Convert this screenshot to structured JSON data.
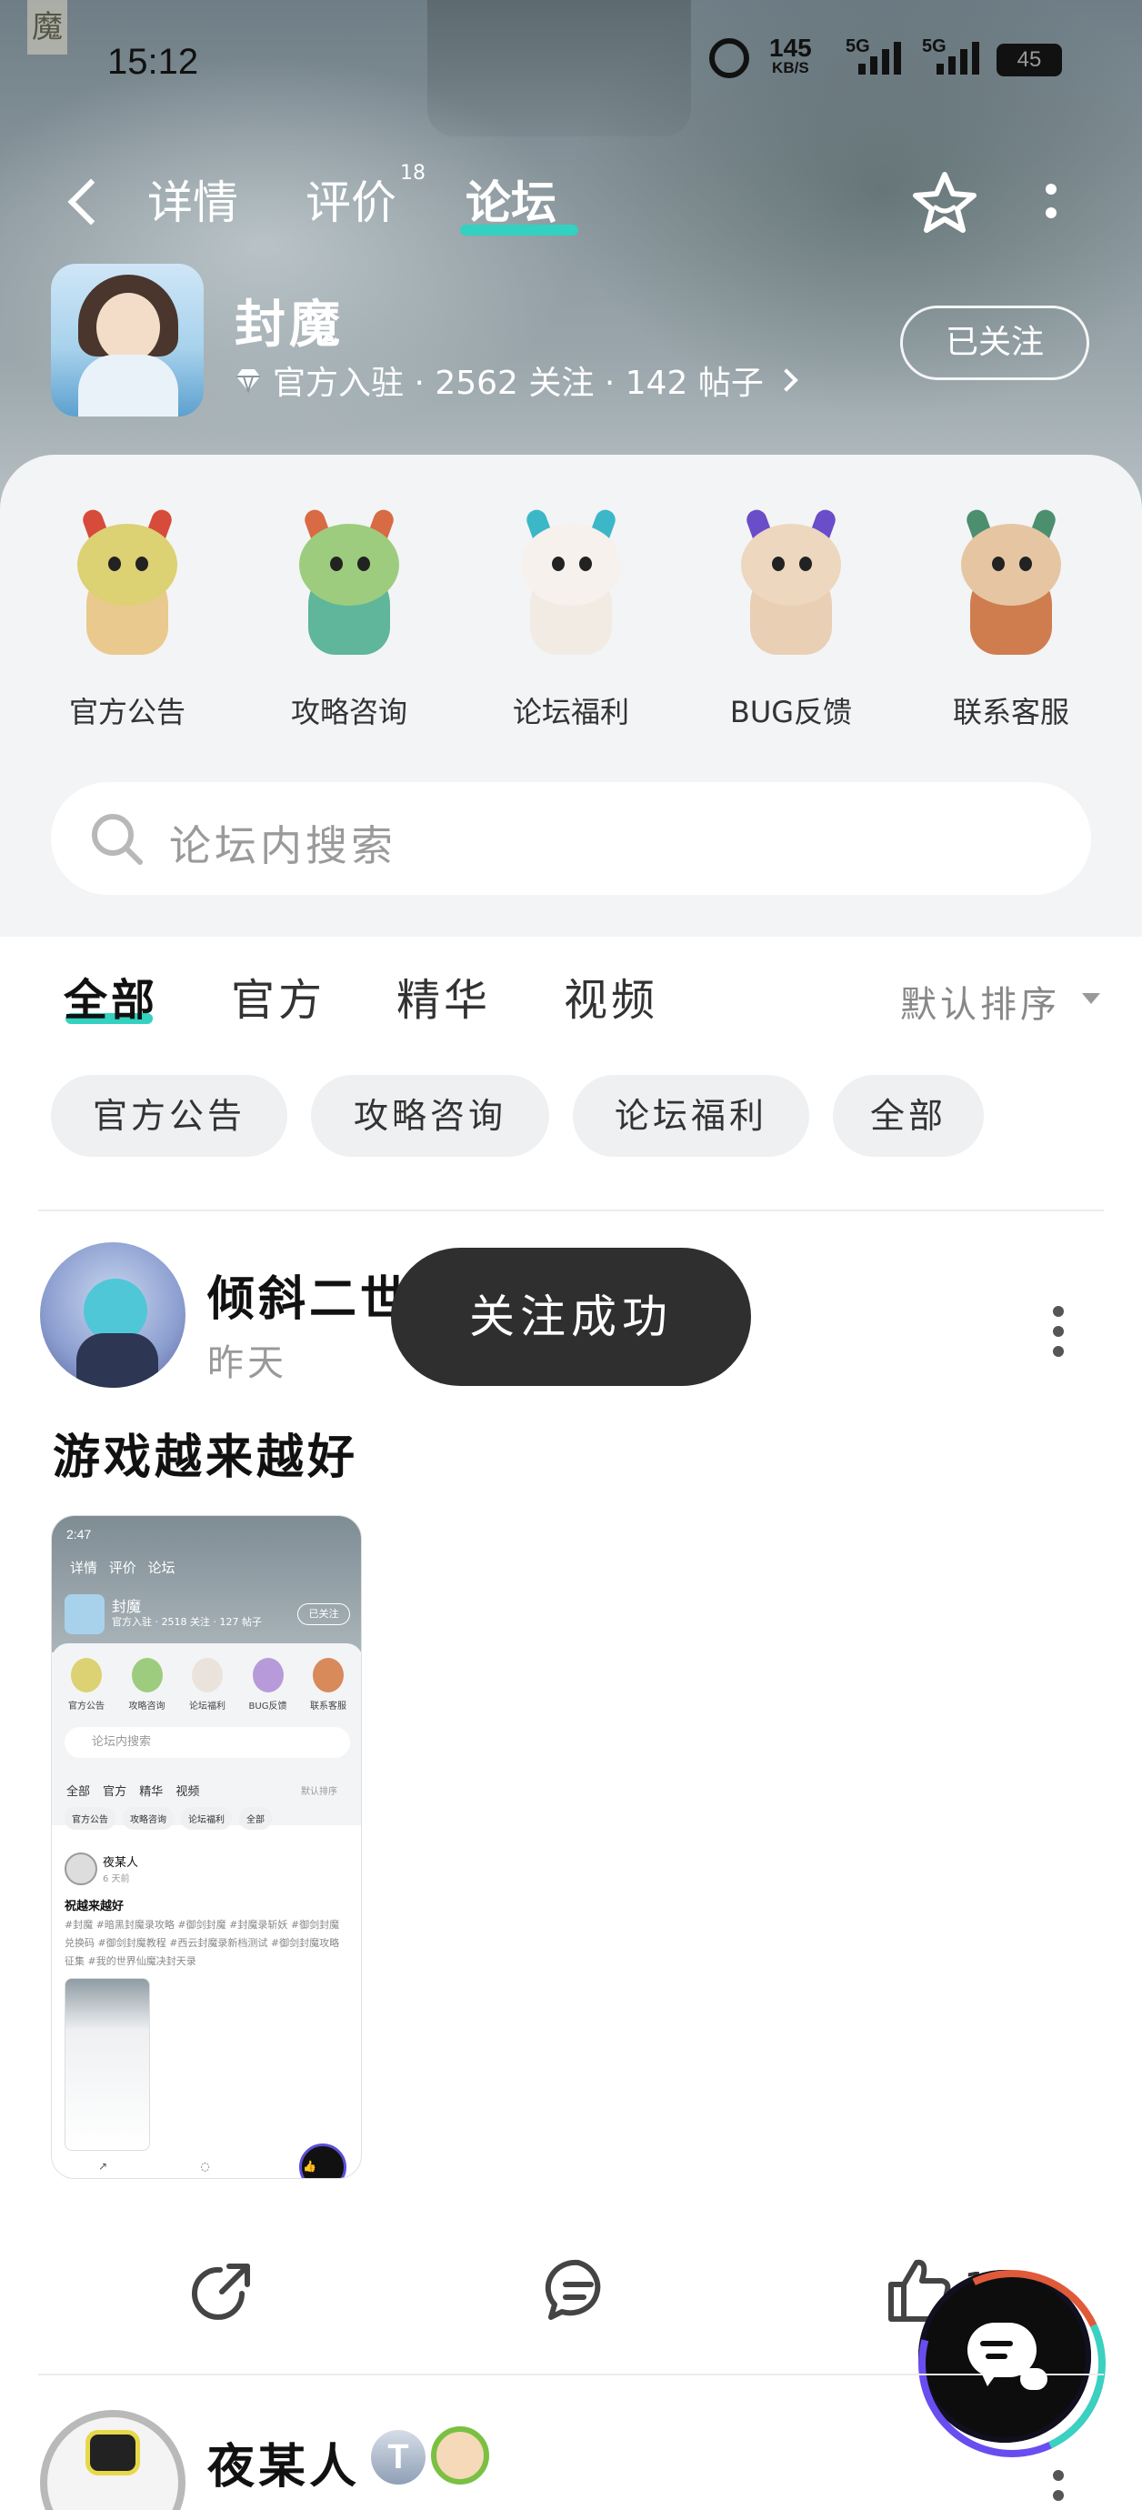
{
  "status_bar": {
    "time": "15:12",
    "net_speed": "145",
    "net_speed_unit": "KB/S",
    "network_1": "5G",
    "network_2": "5G",
    "battery": "45"
  },
  "header": {
    "tabs": [
      {
        "label": "详情"
      },
      {
        "label": "评价"
      },
      {
        "label": "论坛"
      }
    ],
    "active_tab": "论坛",
    "review_count": "18",
    "corner_glyph": "魔"
  },
  "app": {
    "name": "封魔",
    "meta": "官方入驻 · 2562 关注 · 142 帖子",
    "follow_button": "已关注"
  },
  "categories": [
    {
      "label": "官方公告",
      "color": "#d9cf6a"
    },
    {
      "label": "攻略咨询",
      "color": "#8dc47b"
    },
    {
      "label": "论坛福利",
      "color": "#f1ede8"
    },
    {
      "label": "BUG反馈",
      "color": "#e6c7a8"
    },
    {
      "label": "联系客服",
      "color": "#d88a5a"
    }
  ],
  "search": {
    "placeholder": "论坛内搜索"
  },
  "filters": {
    "tabs": [
      {
        "label": "全部"
      },
      {
        "label": "官方"
      },
      {
        "label": "精华"
      },
      {
        "label": "视频"
      }
    ],
    "sort": "默认排序",
    "chips": [
      {
        "label": "官方公告"
      },
      {
        "label": "攻略咨询"
      },
      {
        "label": "论坛福利"
      },
      {
        "label": "全部"
      }
    ]
  },
  "post": {
    "author": "倾斜二世",
    "time": "昨天",
    "title": "游戏越来越好",
    "toast": "关注成功",
    "like_count": "1"
  },
  "nested_shot": {
    "time": "2:47",
    "tabs": "详情 评价 论坛",
    "name": "封魔",
    "meta": "官方入驻 · 2518 关注 · 127 帖子",
    "follow": "已关注",
    "categories": [
      "官方公告",
      "攻略咨询",
      "论坛福利",
      "BUG反馈",
      "联系客服"
    ],
    "search": "论坛内搜索",
    "ftabs": "全部 官方 精华 视频",
    "sort": "默认排序",
    "chips": [
      "官方公告",
      "攻略咨询",
      "论坛福利",
      "全部"
    ],
    "author": "夜某人",
    "ptime": "6 天前",
    "ptitle": "祝越来越好",
    "tags": "#封魔 #暗黑封魔录攻略 #御剑封魔 #封魔录斩妖 #御剑封魔兑换码 #御剑封魔教程 #西云封魔录新档测试 #御剑封魔攻略征集 #我的世界仙魔决封天录"
  },
  "next_post": {
    "author": "夜某人",
    "badge": "T"
  },
  "colors": {
    "accent": "#33d1c0",
    "toast_bg": "#2f2f2f",
    "card_bg": "#f3f4f6"
  }
}
